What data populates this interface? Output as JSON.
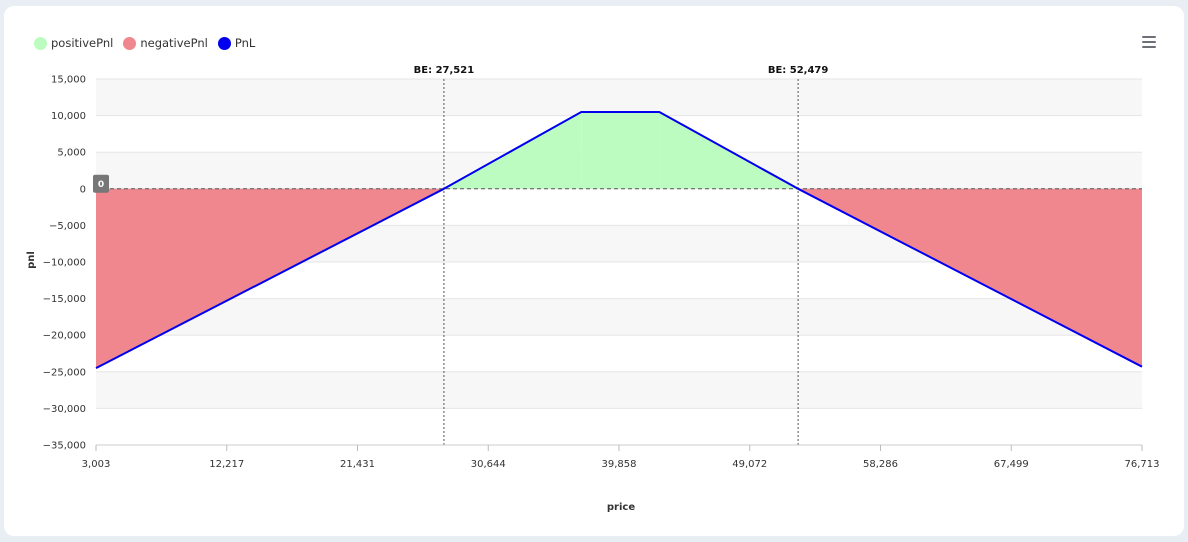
{
  "legend": {
    "items": [
      {
        "label": "positivePnl",
        "color": "#bdfcc0"
      },
      {
        "label": "negativePnl",
        "color": "#f0868e"
      },
      {
        "label": "PnL",
        "color": "#0000ee"
      }
    ]
  },
  "toolbar": {
    "menu_icon": "hamburger-menu-icon"
  },
  "chart_data": {
    "type": "area",
    "xlabel": "price",
    "ylabel": "pnl",
    "xlim": [
      3003,
      76713
    ],
    "ylim": [
      -35000,
      15000
    ],
    "x_ticks": [
      3003,
      12217,
      21431,
      30644,
      39858,
      49072,
      58286,
      67499,
      76713
    ],
    "x_tick_labels": [
      "3,003",
      "12,217",
      "21,431",
      "30,644",
      "39,858",
      "49,072",
      "58,286",
      "67,499",
      "76,713"
    ],
    "y_ticks": [
      15000,
      10000,
      5000,
      0,
      -5000,
      -10000,
      -15000,
      -20000,
      -25000,
      -30000,
      -35000
    ],
    "y_tick_labels": [
      "15,000",
      "10,000",
      "5,000",
      "0",
      "−5,000",
      "−10,000",
      "−15,000",
      "−20,000",
      "−25,000",
      "−30,000",
      "−35,000"
    ],
    "grid": "horizontal bands",
    "series": [
      {
        "name": "PnL",
        "color": "#0000ee",
        "x": [
          3003,
          27521,
          37200,
          42700,
          52479,
          76713
        ],
        "y": [
          -24500,
          0,
          10500,
          10500,
          0,
          -24300
        ]
      }
    ],
    "break_even": [
      {
        "x": 27521,
        "label": "BE: 27,521"
      },
      {
        "x": 52479,
        "label": "BE: 52,479"
      }
    ],
    "zero_line_label": "0",
    "positive_fill": "#bdfcc0",
    "negative_fill": "#f0868e"
  }
}
